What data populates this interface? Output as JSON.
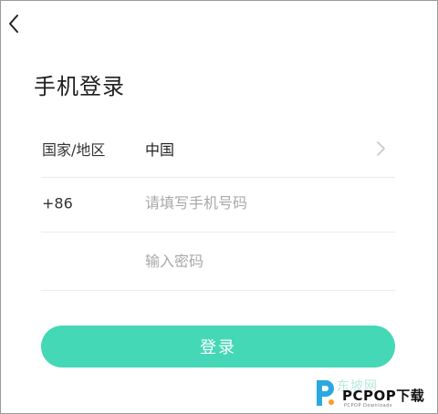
{
  "header": {
    "back_icon": "chevron-left-icon",
    "title": "手机登录"
  },
  "form": {
    "region": {
      "label": "国家/地区",
      "value": "中国",
      "chevron_icon": "chevron-right-icon"
    },
    "phone": {
      "prefix": "+86",
      "value": "",
      "placeholder": "请填写手机号码"
    },
    "password": {
      "value": "",
      "placeholder": "输入密码"
    }
  },
  "login_button": {
    "label": "登录",
    "color": "#44d8b6"
  },
  "watermark": {
    "faint_text": "东坡网",
    "title": "PCPOP下载",
    "subtitle": "PCPOP Downloads",
    "accent_color": "#2aa8e0"
  }
}
